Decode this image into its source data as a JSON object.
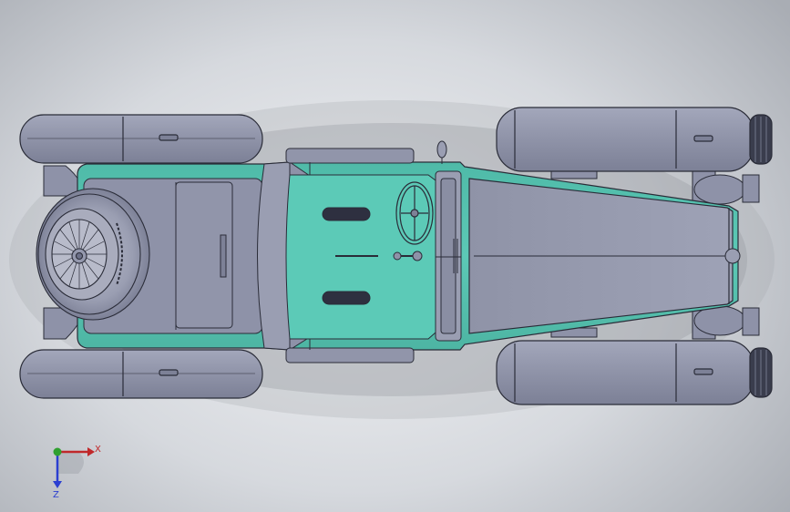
{
  "viewport": {
    "model_name": "vintage-roadster-top-view",
    "body_color": "#58c7b3",
    "part_color": "#8e92a8",
    "edge_color": "#2a2c38"
  },
  "triad": {
    "x_label": "X",
    "z_label": "Z",
    "x_color": "#c0282a",
    "y_color": "#2fa02f",
    "z_color": "#2b3fd1"
  }
}
